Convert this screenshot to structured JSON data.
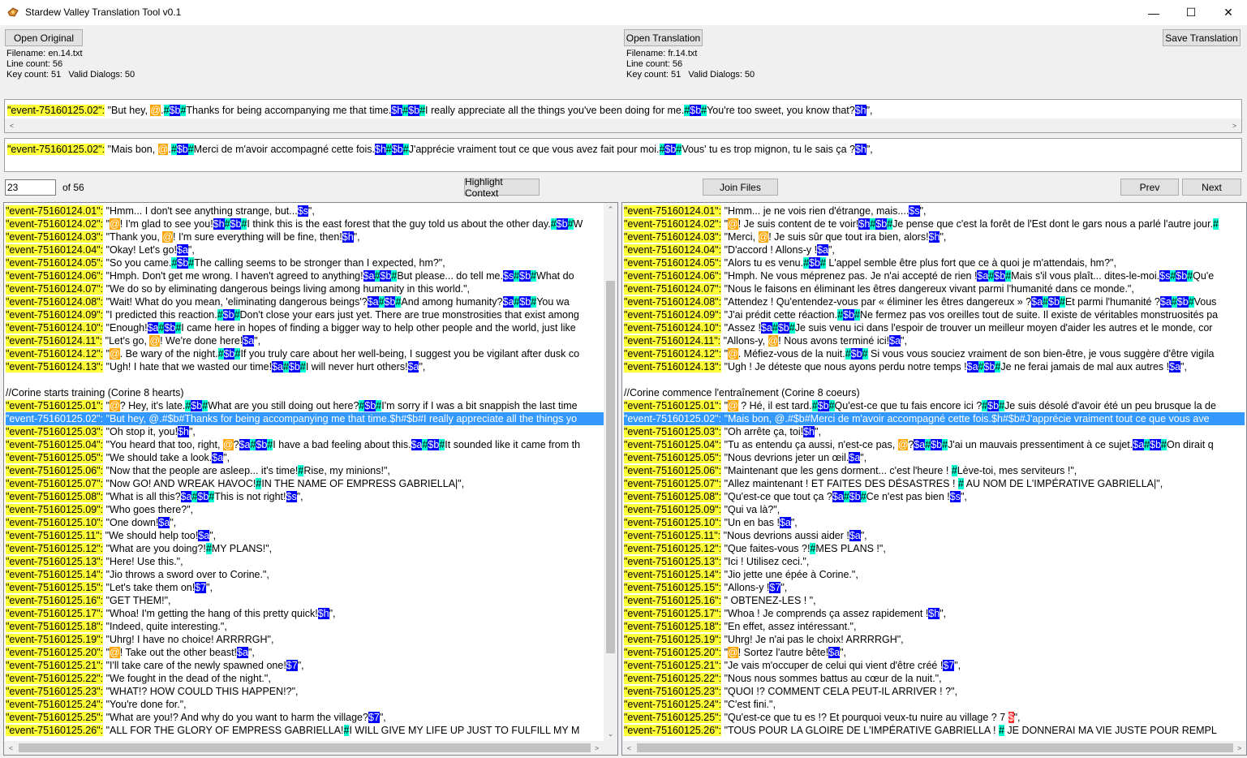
{
  "window": {
    "title": "Stardew Valley Translation Tool v0.1",
    "minimize": "—",
    "maximize": "☐",
    "close": "✕"
  },
  "left_file": {
    "open_label": "Open Original",
    "info": "Filename: en.14.txt\nLine count: 56\nKey count: 51   Valid Dialogs: 50"
  },
  "right_file": {
    "open_label": "Open Translation",
    "info": "Filename: fr.14.txt\nLine count: 56\nKey count: 51   Valid Dialogs: 50"
  },
  "save_label": "Save Translation",
  "current_original": "\"event-75160125.02\": \"But hey, @.#$b#Thanks for being accompanying me that time.$h#$b#I really appreciate all the things you've been doing for me.#$b#You're too sweet, you know that?$h\",",
  "current_translation": "\"event-75160125.02\": \"Mais bon, @.#$b#Merci de m'avoir accompagné cette fois.$h#$b#J'apprécie vraiment tout ce que vous avez fait pour moi.#$b#Vous' tu es trop mignon, tu le sais ça ?$h\",",
  "nav": {
    "line_number": "23",
    "of_label": "of 56",
    "highlight_label": "Highlight Context",
    "join_label": "Join Files",
    "prev_label": "Prev",
    "next_label": "Next"
  },
  "left_lines": [
    "\"event-75160124.01\": \"Hmm... I don't see anything strange, but...$s\",",
    "\"event-75160124.02\": \"@! I'm glad to see you!$h#$b#I think this is the east forest that the guy told us about the other day.#$b#W",
    "\"event-75160124.03\": \"Thank you, @! I'm sure everything will be fine, then!$h\",",
    "\"event-75160124.04\": \"Okay! Let's go!$a\",",
    "\"event-75160124.05\": \"So you came.#$b#The calling seems to be stronger than I expected, hm?\",",
    "\"event-75160124.06\": \"Hmph. Don't get me wrong. I haven't agreed to anything!$a#$b#But please... do tell me.$s#$b#What do",
    "\"event-75160124.07\": \"We do so by eliminating dangerous beings living among humanity in this world.\",",
    "\"event-75160124.08\": \"Wait! What do you mean, 'eliminating dangerous beings'?$a#$b#And among humanity?$a#$b#You wa",
    "\"event-75160124.09\": \"I predicted this reaction.#$b#Don't close your ears just yet. There are true monstrosities that exist among",
    "\"event-75160124.10\": \"Enough!$a#$b#I came here in hopes of finding a bigger way to help other people and the world, just like",
    "\"event-75160124.11\": \"Let's go, @! We're done here!$a\",",
    "\"event-75160124.12\": \"@. Be wary of the night.#$b#If you truly care about her well-being, I suggest you be vigilant after dusk co",
    "\"event-75160124.13\": \"Ugh! I hate that we wasted our time!$a#$b#I will never hurt others!$a\",",
    "",
    "//Corine starts training (Corine 8 hearts)",
    "\"event-75160125.01\": \"@? Hey, it's late.#$b#What are you still doing out here?#$b#I'm sorry if I was a bit snappish the last time",
    "\"event-75160125.02\": \"But hey, @.#$b#Thanks for being accompanying me that time.$h#$b#I really appreciate all the things yo",
    "\"event-75160125.03\": \"Oh stop it, you!$h\",",
    "\"event-75160125.04\": \"You heard that too, right, @?$a#$b#I have a bad feeling about this.$a#$b#It sounded like it came from th",
    "\"event-75160125.05\": \"We should take a look.$a\",",
    "\"event-75160125.06\": \"Now that the people are asleep... it's time!#Rise, my minions!\",",
    "\"event-75160125.07\": \"Now GO! AND WREAK HAVOC!#IN THE NAME OF EMPRESS GABRIELLA|\",",
    "\"event-75160125.08\": \"What is all this?$a#$b#This is not right!$s\",",
    "\"event-75160125.09\": \"Who goes there?\",",
    "\"event-75160125.10\": \"One down!$a\",",
    "\"event-75160125.11\": \"We should help too!$a\",",
    "\"event-75160125.12\": \"What are you doing?!#MY PLANS!\",",
    "\"event-75160125.13\": \"Here! Use this.\",",
    "\"event-75160125.14\": \"Jio throws a sword over to Corine.\",",
    "\"event-75160125.15\": \"Let's take them on!$7\",",
    "\"event-75160125.16\": \"GET THEM!\",",
    "\"event-75160125.17\": \"Whoa! I'm getting the hang of this pretty quick!$h\",",
    "\"event-75160125.18\": \"Indeed, quite interesting.\",",
    "\"event-75160125.19\": \"Uhrg! I have no choice! ARRRRGH\",",
    "\"event-75160125.20\": \"@! Take out the other beast!$a\",",
    "\"event-75160125.21\": \"I'll take care of the newly spawned one!$7\",",
    "\"event-75160125.22\": \"We fought in the dead of the night.\",",
    "\"event-75160125.23\": \"WHAT!? HOW COULD THIS HAPPEN!?\",",
    "\"event-75160125.24\": \"You're done for.\",",
    "\"event-75160125.25\": \"What are you!? And why do you want to harm the village?$7\",",
    "\"event-75160125.26\": \"ALL FOR THE GLORY OF EMPRESS GABRIELLA!#I WILL GIVE MY LIFE UP JUST TO FULFILL MY M"
  ],
  "right_lines": [
    "\"event-75160124.01\": \"Hmm... je ne vois rien d'étrange, mais....$s\",",
    "\"event-75160124.02\": \"@! Je suis content de te voir!$h#$b#Je pense que c'est la forêt de l'Est dont le gars nous a parlé l'autre jour.#",
    "\"event-75160124.03\": \"Merci, @! Je suis sûr que tout ira bien, alors!$h\",",
    "\"event-75160124.04\": \"D'accord ! Allons-y !$a\",",
    "\"event-75160124.05\": \"Alors tu es venu.#$b# L'appel semble être plus fort que ce à quoi je m'attendais, hm?\",",
    "\"event-75160124.06\": \"Hmph. Ne vous méprenez pas. Je n'ai accepté de rien !$a#$b#Mais s'il vous plaît... dites-le-moi.$s#$b#Qu'e",
    "\"event-75160124.07\": \"Nous le faisons en éliminant les êtres dangereux vivant parmi l'humanité dans ce monde.\",",
    "\"event-75160124.08\": \"Attendez ! Qu'entendez-vous par « éliminer les êtres dangereux » ?$a#$b#Et parmi l'humanité ?$a#$b#Vous",
    "\"event-75160124.09\": \"J'ai prédit cette réaction.#$b#Ne fermez pas vos oreilles tout de suite. Il existe de véritables monstruosités pa",
    "\"event-75160124.10\": \"Assez !$a#$b#Je suis venu ici dans l'espoir de trouver un meilleur moyen d'aider les autres et le monde, cor",
    "\"event-75160124.11\": \"Allons-y, @! Nous avons terminé ici!$a\",",
    "\"event-75160124.12\": \"@. Méfiez-vous de la nuit.#$b# Si vous vous souciez vraiment de son bien-être, je vous suggère d'être vigila",
    "\"event-75160124.13\": \"Ugh ! Je déteste que nous ayons perdu notre temps !$a#$b#Je ne ferai jamais de mal aux autres !$a\",",
    "",
    "//Corine commence l'entraînement (Corine 8 coeurs)",
    "\"event-75160125.01\": \"@ ? Hé, il est tard.#$b#Qu'est-ce que tu fais encore ici ?#$b#Je suis désolé d'avoir été un peu brusque la de",
    "\"event-75160125.02\": \"Mais bon, @.#$b#Merci de m'avoir accompagné cette fois.$h#$b#J'apprécie vraiment tout ce que vous ave",
    "\"event-75160125.03\": \"Oh arrête ça, toi!$h\",",
    "\"event-75160125.04\": \"Tu as entendu ça aussi, n'est-ce pas, @?$a#$b#J'ai un mauvais pressentiment à ce sujet.$a#$b#On dirait q",
    "\"event-75160125.05\": \"Nous devrions jeter un œil.$a\",",
    "\"event-75160125.06\": \"Maintenant que les gens dorment... c'est l'heure ! #Lève-toi, mes serviteurs !\",",
    "\"event-75160125.07\": \"Allez maintenant ! ET FAITES DES DÉSASTRES ! # AU NOM DE L'IMPÉRATIVE GABRIELLA|\",",
    "\"event-75160125.08\": \"Qu'est-ce que tout ça ?$a#$b#Ce n'est pas bien !$s\",",
    "\"event-75160125.09\": \"Qui va là?\",",
    "\"event-75160125.10\": \"Un en bas !$a\",",
    "\"event-75160125.11\": \"Nous devrions aussi aider !$a\",",
    "\"event-75160125.12\": \"Que faites-vous ?!#MES PLANS !\",",
    "\"event-75160125.13\": \"Ici ! Utilisez ceci.\",",
    "\"event-75160125.14\": \"Jio jette une épée à Corine.\",",
    "\"event-75160125.15\": \"Allons-y !$7\",",
    "\"event-75160125.16\": \" OBTENEZ-LES ! \",",
    "\"event-75160125.17\": \"Whoa ! Je comprends ça assez rapidement !$h\",",
    "\"event-75160125.18\": \"En effet, assez intéressant.\",",
    "\"event-75160125.19\": \"Uhrg! Je n'ai pas le choix! ARRRRGH\",",
    "\"event-75160125.20\": \"@! Sortez l'autre bête!$a\",",
    "\"event-75160125.21\": \"Je vais m'occuper de celui qui vient d'être créé !$7\",",
    "\"event-75160125.22\": \"Nous nous sommes battus au cœur de la nuit.\",",
    "\"event-75160125.23\": \"QUOI !? COMMENT CELA PEUT-IL ARRIVER ! ?\",",
    "\"event-75160125.24\": \"C'est fini.\",",
    "\"event-75160125.25\": \"Qu'est-ce que tu es !? Et pourquoi veux-tu nuire au village ? 7 $\",",
    "\"event-75160125.26\": \"TOUS POUR LA GLOIRE DE L'IMPÉRATIVE GABRIELLA ! # JE DONNERAI MA VIE JUSTE POUR REMPL"
  ],
  "selected_row_index": 16,
  "colors": {
    "key_highlight": "#ffff38",
    "token_highlight": "#0000ff",
    "separator_highlight": "#00ffd0",
    "player_highlight": "#ffa500",
    "error_highlight": "#ff3030",
    "selection": "#3399ff"
  },
  "icons": {
    "app": "app-icon",
    "minimize": "minimize-icon",
    "maximize": "maximize-icon",
    "close": "close-icon"
  }
}
